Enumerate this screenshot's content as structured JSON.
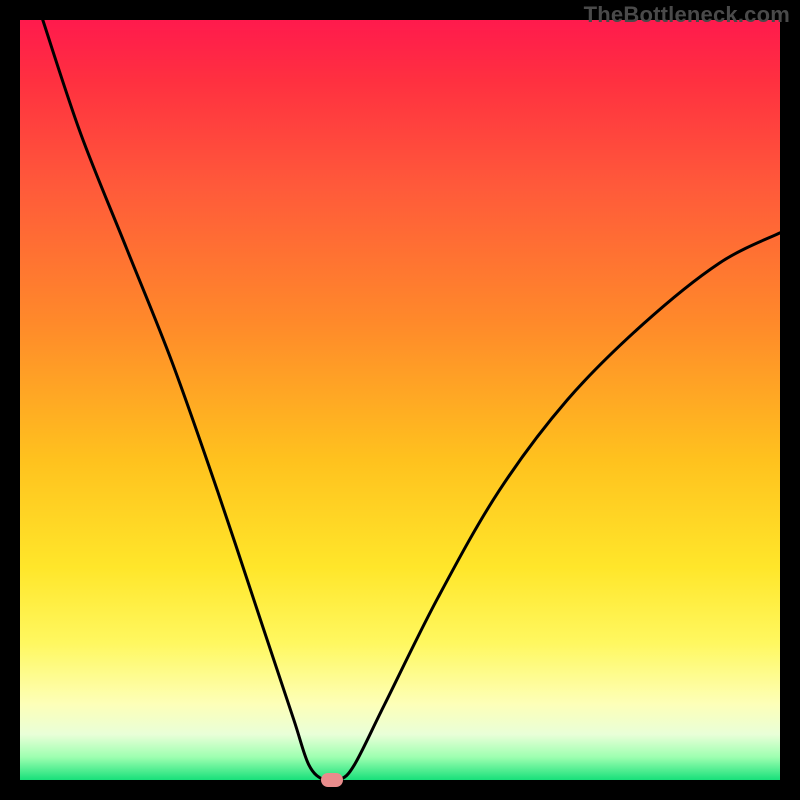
{
  "watermark": "TheBottleneck.com",
  "colors": {
    "frame": "#000000",
    "curve": "#000000",
    "marker": "#e98c8c",
    "gradient_top": "#ff1a4d",
    "gradient_bottom": "#18e07a"
  },
  "chart_data": {
    "type": "line",
    "title": "",
    "xlabel": "",
    "ylabel": "",
    "xlim": [
      0,
      100
    ],
    "ylim": [
      0,
      100
    ],
    "grid": false,
    "legend": false,
    "series": [
      {
        "name": "bottleneck-curve",
        "points": [
          {
            "x": 3,
            "y": 100
          },
          {
            "x": 8,
            "y": 85
          },
          {
            "x": 14,
            "y": 70
          },
          {
            "x": 20,
            "y": 55
          },
          {
            "x": 26,
            "y": 38
          },
          {
            "x": 32,
            "y": 20
          },
          {
            "x": 36,
            "y": 8
          },
          {
            "x": 38,
            "y": 2
          },
          {
            "x": 40,
            "y": 0
          },
          {
            "x": 42,
            "y": 0
          },
          {
            "x": 44,
            "y": 2
          },
          {
            "x": 48,
            "y": 10
          },
          {
            "x": 55,
            "y": 24
          },
          {
            "x": 63,
            "y": 38
          },
          {
            "x": 72,
            "y": 50
          },
          {
            "x": 82,
            "y": 60
          },
          {
            "x": 92,
            "y": 68
          },
          {
            "x": 100,
            "y": 72
          }
        ]
      }
    ],
    "marker": {
      "x": 41,
      "y": 0
    },
    "note": "Values are read off the figure proportionally (0–100 on each axis; y=0 at the green bottom, y=100 at the red top). The curve dips to a minimum of 0 around x≈40–42 and rises on both sides; the pink marker sits at the curve minimum."
  }
}
